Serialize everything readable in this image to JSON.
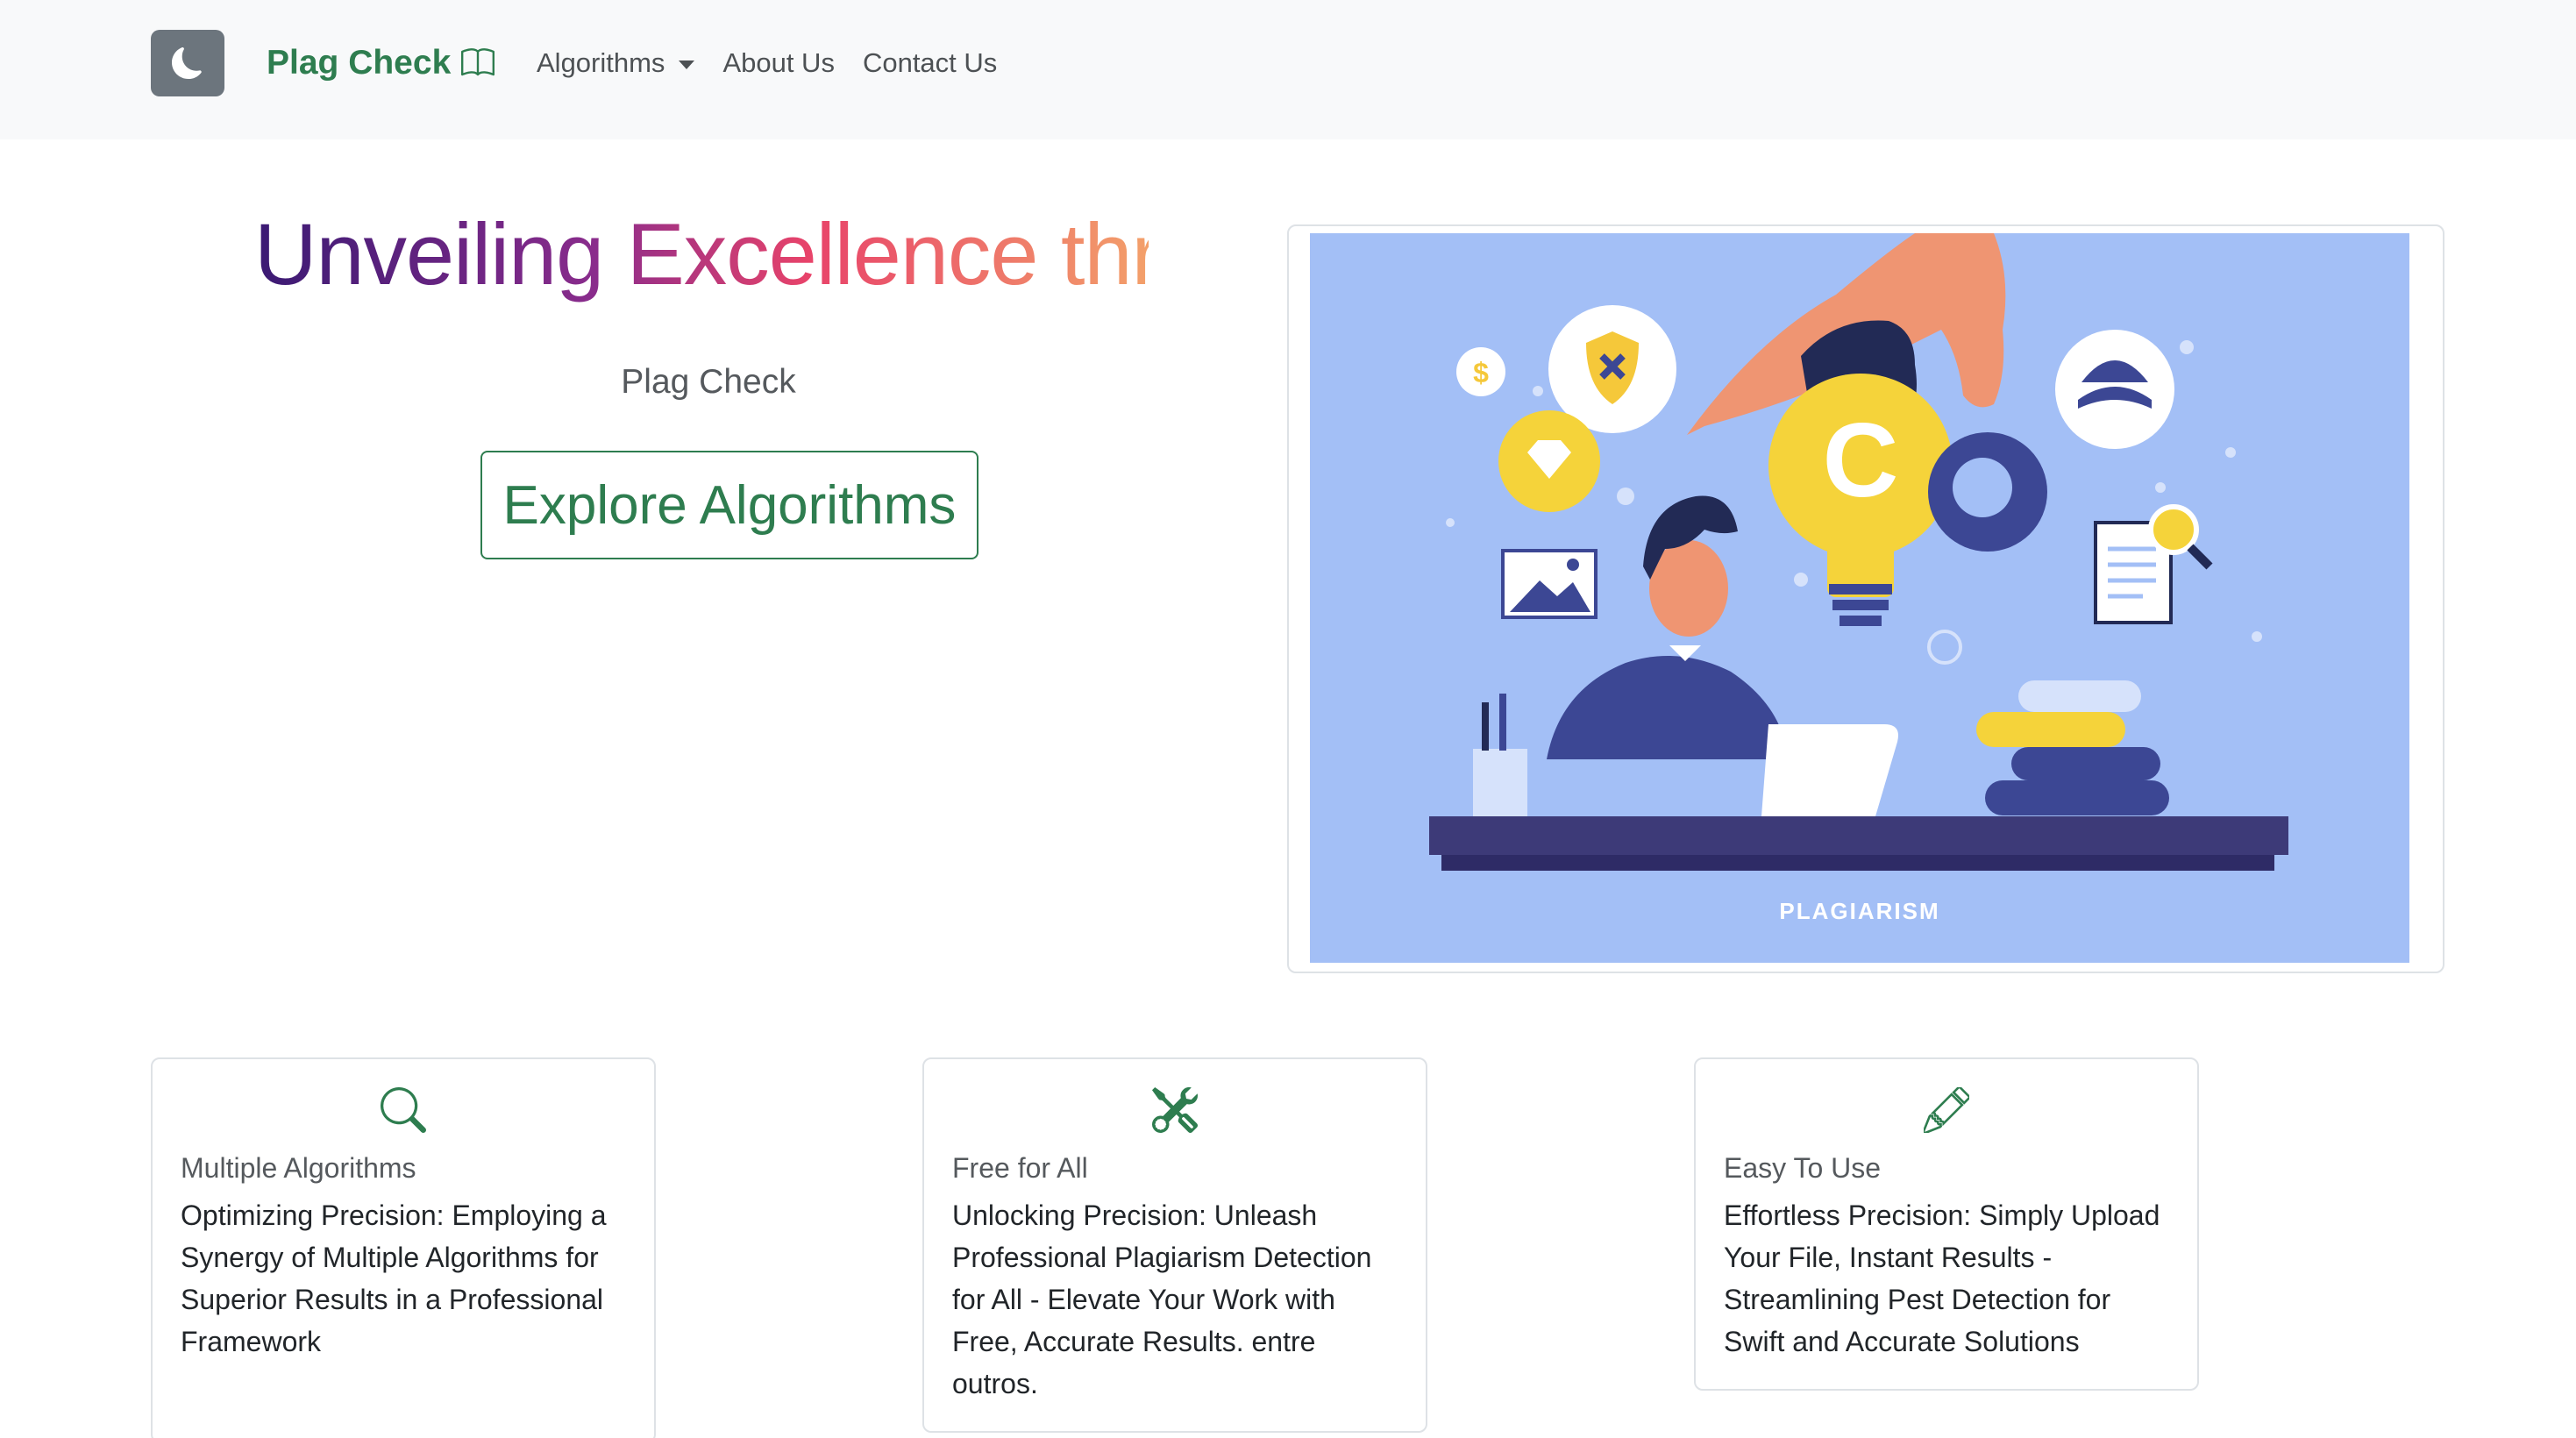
{
  "navbar": {
    "brand": "Plag Check",
    "links": [
      {
        "label": "Algorithms",
        "dropdown": true
      },
      {
        "label": "About Us"
      },
      {
        "label": "Contact Us"
      }
    ]
  },
  "hero": {
    "title": "Unveiling Excellence thr",
    "subtitle": "Plag Check",
    "button": "Explore Algorithms"
  },
  "illustration": {
    "caption": "PLAGIARISM",
    "logo_letter": "C",
    "coin_symbol": "$"
  },
  "features": [
    {
      "icon": "search-icon",
      "title": "Multiple Algorithms",
      "text": "Optimizing Precision: Employing a Synergy of Multiple Algorithms for Superior Results in a Professional Framework"
    },
    {
      "icon": "tools-icon",
      "title": "Free for All",
      "text": "Unlocking Precision: Unleash Professional Plagiarism Detection for All - Elevate Your Work with Free, Accurate Results. entre outros."
    },
    {
      "icon": "pencil-icon",
      "title": "Easy To Use",
      "text": "Effortless Precision: Simply Upload Your File, Instant Results - Streamlining Pest Detection for Swift and Accurate Solutions"
    }
  ],
  "colors": {
    "brand": "#2e7d4f",
    "navbar_bg": "#f8f9fa",
    "theme_button": "#6c757d",
    "illustration_bg": "#a3bff6"
  }
}
